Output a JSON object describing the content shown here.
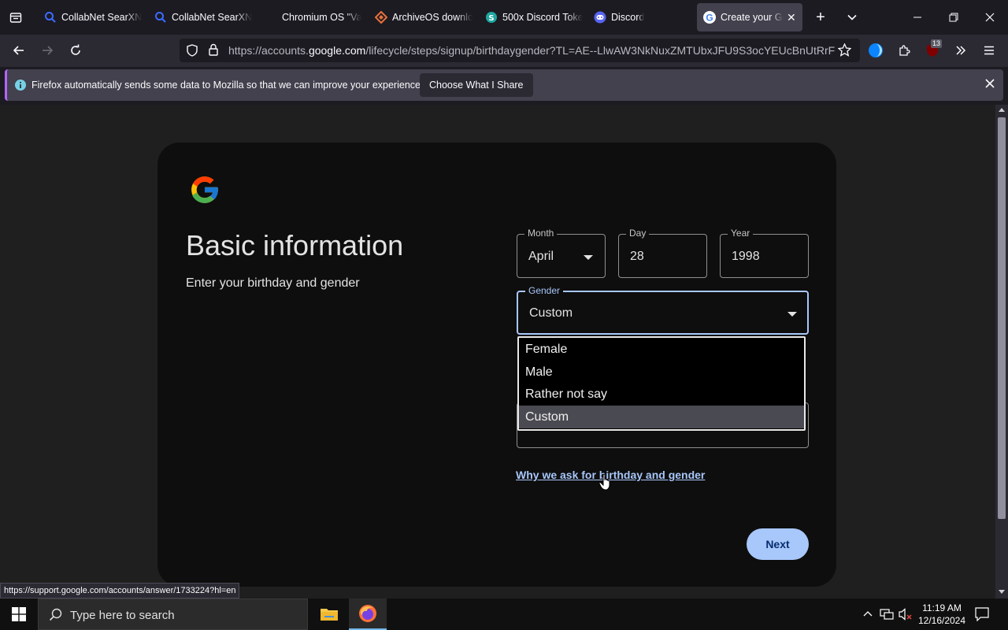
{
  "tabs": [
    {
      "title": "CollabNet SearXN",
      "icon": "search-icon",
      "active": false
    },
    {
      "title": "CollabNet SearXN",
      "icon": "search-icon",
      "active": false
    },
    {
      "title": "Chromium OS \"Va",
      "icon": "none",
      "active": false
    },
    {
      "title": "ArchiveOS downlo",
      "icon": "archive-icon",
      "active": false
    },
    {
      "title": "500x Discord Toke",
      "icon": "discord-token-icon",
      "active": false
    },
    {
      "title": "Discord",
      "icon": "discord-icon",
      "active": false
    },
    {
      "title": "Create your Goo",
      "icon": "google-icon",
      "active": true
    }
  ],
  "url": {
    "prefix": "https://accounts.",
    "domain": "google.com",
    "suffix": "/lifecycle/steps/signup/birthdaygender?TL=AE--LlwAW3NkNuxZMTUbxJFU9S3ocYEUcBnUtRrFUR"
  },
  "extensions_badge": "13",
  "notification": {
    "text": "Firefox automatically sends some data to Mozilla so that we can improve your experience.",
    "button": "Choose What I Share"
  },
  "form": {
    "title": "Basic information",
    "subtitle": "Enter your birthday and gender",
    "month_label": "Month",
    "month_value": "April",
    "day_label": "Day",
    "day_value": "28",
    "year_label": "Year",
    "year_value": "1998",
    "gender_label": "Gender",
    "gender_value": "Custom",
    "gender_options": [
      "Female",
      "Male",
      "Rather not say",
      "Custom"
    ],
    "why_link": "Why we ask for birthday and gender",
    "next_button": "Next"
  },
  "status_url": "https://support.google.com/accounts/answer/1733224?hl=en",
  "taskbar": {
    "search_placeholder": "Type here to search",
    "time": "11:19 AM",
    "date": "12/16/2024"
  },
  "colors": {
    "accent_blue": "#a8c7fa",
    "notification_accent": "#b366ff",
    "card_background": "#0e0e0e"
  }
}
